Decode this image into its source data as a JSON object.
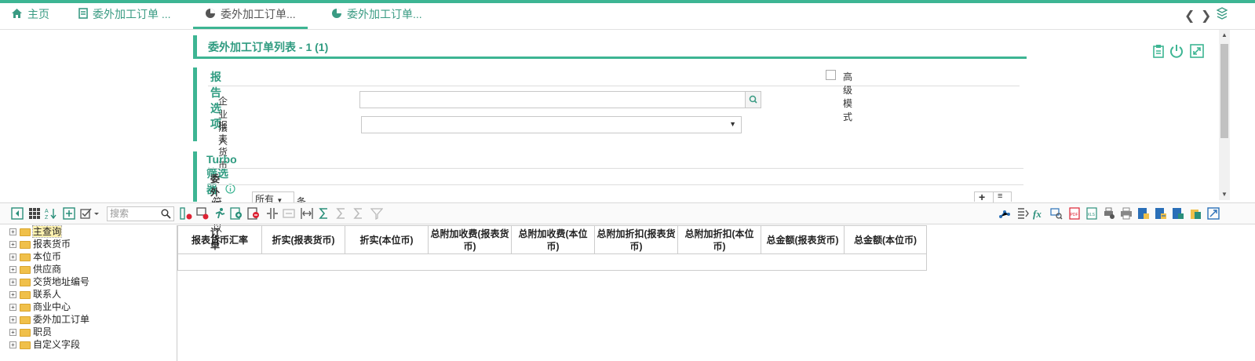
{
  "tabs": [
    {
      "label": "主页",
      "icon": "home-icon"
    },
    {
      "label": "委外加工订单 ...",
      "icon": "document-edit-icon"
    },
    {
      "label": "委外加工订单...",
      "icon": "pie-chart-icon"
    },
    {
      "label": "委外加工订单...",
      "icon": "pie-chart-icon"
    }
  ],
  "header": {
    "title": "委外加工订单列表 - 1 (1)"
  },
  "report_options": {
    "title": "报告选项",
    "advanced_mode_label": "高级模式",
    "company_label": "企业法人",
    "company_value": "",
    "currency_label": "报表货币",
    "currency_value": ""
  },
  "turbo": {
    "title": "Turbo筛选器",
    "subtitle": "委外加工订单",
    "match_prefix": "符合以下",
    "match_value": "所有",
    "match_suffix": "条件"
  },
  "toolbar": {
    "search_placeholder": "搜索"
  },
  "tree": [
    {
      "label": "主查询",
      "selected": true
    },
    {
      "label": "报表货币"
    },
    {
      "label": "本位币"
    },
    {
      "label": "供应商"
    },
    {
      "label": "交货地址编号"
    },
    {
      "label": "联系人"
    },
    {
      "label": "商业中心"
    },
    {
      "label": "委外加工订单"
    },
    {
      "label": "职员"
    },
    {
      "label": "自定义字段"
    }
  ],
  "grid": {
    "columns": [
      "报表货币汇率",
      "折实(报表货币)",
      "折实(本位币)",
      "总附加收费(报表货币)",
      "总附加收费(本位币)",
      "总附加折扣(报表货币)",
      "总附加折扣(本位币)",
      "总金额(报表货币)",
      "总金额(本位币)"
    ]
  },
  "colors": {
    "accent": "#3db593",
    "title": "#2f9b80"
  }
}
